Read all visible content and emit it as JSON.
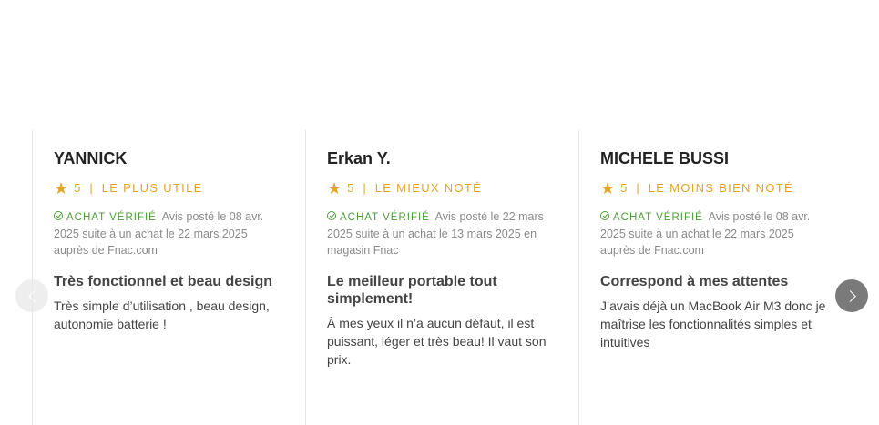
{
  "colors": {
    "accent": "#e1a526",
    "verified": "#4d9a36",
    "nav_active": "#7a7a7a",
    "nav_disabled": "#e8e8e8"
  },
  "reviews": [
    {
      "author": "YANNICK",
      "rating": "5",
      "separator": "|",
      "tag": "Le plus utile",
      "verified_label": "Achat vérifié",
      "meta": "Avis posté le 08 avr. 2025 suite à un achat le 22 mars 2025 auprès de Fnac.com",
      "title": "Très fonctionnel et beau design",
      "body": "Très simple d’utilisation , beau design, autonomie batterie !"
    },
    {
      "author": "Erkan Y.",
      "rating": "5",
      "separator": "|",
      "tag": "Le mieux noté",
      "verified_label": "Achat vérifié",
      "meta": "Avis posté le 22 mars 2025 suite à un achat le 13 mars 2025 en magasin Fnac",
      "title": "Le meilleur portable tout simplement!",
      "body": "À mes yeux il n’a aucun défaut, il est puissant, léger et très beau! Il vaut son prix."
    },
    {
      "author": "MICHELE BUSSI",
      "rating": "5",
      "separator": "|",
      "tag": "Le moins bien noté",
      "verified_label": "Achat vérifié",
      "meta": "Avis posté le 08 avr. 2025 suite à un achat le 22 mars 2025 auprès de Fnac.com",
      "title": "Correspond à mes attentes",
      "body": "J’avais déjà un MacBook Air M3 donc je maîtrise les fonctionnalités simples et intuitives"
    }
  ],
  "icons": {
    "star": "star-icon",
    "verified": "check-circle-icon",
    "prev": "chevron-left-icon",
    "next": "chevron-right-icon"
  }
}
